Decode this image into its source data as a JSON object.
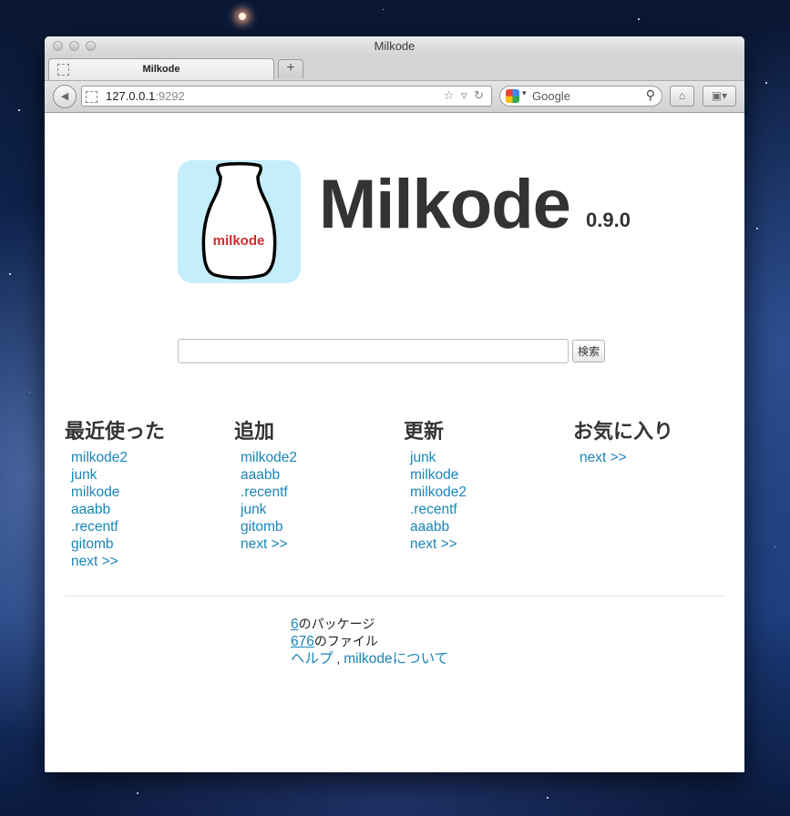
{
  "window": {
    "title": "Milkode"
  },
  "tab": {
    "label": "Milkode",
    "new_tab_symbol": "+"
  },
  "toolbar": {
    "url_host": "127.0.0.1",
    "url_port": ":9292",
    "search_placeholder": "Google",
    "back_icon": "◀",
    "url_icons": "☆ ▿ ↻",
    "home_icon": "⌂",
    "bookmarks_icon": "▣▾",
    "search_icon": "⚲"
  },
  "logo": {
    "badge_text": "milkode",
    "title": "Milkode",
    "version": "0.9.0"
  },
  "search": {
    "button_label": "検索",
    "value": ""
  },
  "sections": {
    "recent": {
      "heading": "最近使った",
      "items": [
        "milkode2",
        "junk",
        "milkode",
        "aaabb",
        ".recentf",
        "gitomb",
        "next >>"
      ]
    },
    "added": {
      "heading": "追加",
      "items": [
        "milkode2",
        "aaabb",
        ".recentf",
        "junk",
        "gitomb",
        "next >>"
      ]
    },
    "updated": {
      "heading": "更新",
      "items": [
        "junk",
        "milkode",
        "milkode2",
        ".recentf",
        "aaabb",
        "next >>"
      ]
    },
    "favorites": {
      "heading": "お気に入り",
      "items": [
        "next >>"
      ]
    }
  },
  "stats": {
    "packages_count": "6",
    "packages_label": "のパッケージ",
    "files_count": "676",
    "files_label": "のファイル",
    "help_link": "ヘルプ",
    "separator": " , ",
    "about_link": "milkodeについて"
  },
  "colors": {
    "link": "#1a85b8",
    "logo_bg": "#c4eefc",
    "badge_text": "#d42a2a"
  }
}
